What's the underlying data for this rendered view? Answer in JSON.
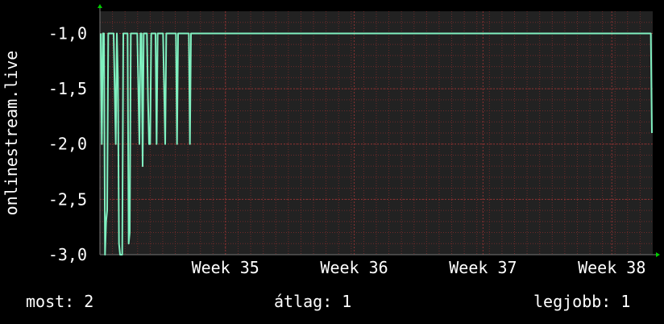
{
  "chart_data": {
    "type": "line",
    "ylabel": "onlinestream.live",
    "ylim": [
      -3.0,
      -0.8
    ],
    "y_ticks": [
      {
        "value": -1.0,
        "label": "-1,0"
      },
      {
        "value": -1.5,
        "label": "-1,5"
      },
      {
        "value": -2.0,
        "label": "-2,0"
      },
      {
        "value": -2.5,
        "label": "-2,5"
      },
      {
        "value": -3.0,
        "label": "-3,0"
      }
    ],
    "x_ticks": [
      {
        "position": 0.227,
        "label": "Week 35"
      },
      {
        "position": 0.46,
        "label": "Week 36"
      },
      {
        "position": 0.693,
        "label": "Week 37"
      },
      {
        "position": 0.926,
        "label": "Week 38"
      }
    ],
    "series": [
      {
        "color": "#80f0c0",
        "values": [
          -1.0,
          -2.0,
          -1.0,
          -1.0,
          -3.0,
          -2.7,
          -2.6,
          -1.0,
          -1.0,
          -1.0,
          -1.0,
          -1.0,
          -1.0,
          -1.5,
          -2.0,
          -1.0,
          -1.4,
          -2.9,
          -3.0,
          -3.0,
          -3.0,
          -1.0,
          -1.0,
          -1.0,
          -1.0,
          -1.0,
          -2.9,
          -2.8,
          -1.0,
          -1.0,
          -1.0,
          -1.0,
          -1.0,
          -1.0,
          -1.0,
          -1.5,
          -2.0,
          -1.0,
          -1.0,
          -2.2,
          -1.0,
          -1.0,
          -1.0,
          -1.0,
          -1.6,
          -2.0,
          -2.0,
          -1.0,
          -1.0,
          -1.0,
          -1.0,
          -1.0,
          -2.0,
          -1.0,
          -1.0,
          -1.0,
          -1.0,
          -1.0,
          -1.0,
          -1.5,
          -2.0,
          -1.0,
          -1.0,
          -1.0,
          -1.0,
          -1.0,
          -1.0,
          -1.0,
          -1.0,
          -1.0,
          -1.0,
          -2.0,
          -1.0,
          -1.0,
          -1.0,
          -1.0,
          -1.0,
          -1.0,
          -1.0,
          -1.0,
          -1.0,
          -1.0,
          -1.0,
          -2.0,
          -1.0,
          -1.0,
          -1.0,
          -1.0,
          -1.0,
          -1.0,
          -1.0,
          -1.0,
          -1.0,
          -1.0,
          -1.0,
          -1.0,
          -1.0,
          -1.0,
          -1.0,
          -1.0,
          -1.0,
          -1.0,
          -1.0,
          -1.0,
          -1.0,
          -1.0,
          -1.0,
          -1.0,
          -1.0,
          -1.0,
          -1.0,
          -1.0,
          -1.0,
          -1.0,
          -1.0,
          -1.0,
          -1.0,
          -1.0,
          -1.0,
          -1.0,
          -1.0,
          -1.0,
          -1.0,
          -1.0,
          -1.0,
          -1.0,
          -1.0,
          -1.0,
          -1.0,
          -1.0,
          -1.0,
          -1.0,
          -1.0,
          -1.0,
          -1.0,
          -1.0,
          -1.0,
          -1.0,
          -1.0,
          -1.0,
          -1.0,
          -1.0,
          -1.0,
          -1.0,
          -1.0,
          -1.0,
          -1.0,
          -1.0,
          -1.0,
          -1.0,
          -1.0,
          -1.0,
          -1.0,
          -1.0,
          -1.0,
          -1.0,
          -1.0,
          -1.0,
          -1.0,
          -1.0,
          -1.0,
          -1.0,
          -1.0,
          -1.0,
          -1.0,
          -1.0,
          -1.0,
          -1.0,
          -1.0,
          -1.0,
          -1.0,
          -1.0,
          -1.0,
          -1.0,
          -1.0,
          -1.0,
          -1.0,
          -1.0,
          -1.0,
          -1.0,
          -1.0,
          -1.0,
          -1.0,
          -1.0,
          -1.0,
          -1.0,
          -1.0,
          -1.0,
          -1.0,
          -1.0,
          -1.0,
          -1.0,
          -1.0,
          -1.0,
          -1.0,
          -1.0,
          -1.0,
          -1.0,
          -1.0,
          -1.0,
          -1.0,
          -1.0,
          -1.0,
          -1.0,
          -1.0,
          -1.0,
          -1.0,
          -1.0,
          -1.0,
          -1.0,
          -1.0,
          -1.0,
          -1.0,
          -1.0,
          -1.0,
          -1.0,
          -1.0,
          -1.0,
          -1.0,
          -1.0,
          -1.0,
          -1.0,
          -1.0,
          -1.0,
          -1.0,
          -1.0,
          -1.0,
          -1.0,
          -1.0,
          -1.0,
          -1.0,
          -1.0,
          -1.0,
          -1.0,
          -1.0,
          -1.0,
          -1.0,
          -1.0,
          -1.0,
          -1.0,
          -1.0,
          -1.0,
          -1.0,
          -1.0,
          -1.0,
          -1.0,
          -1.0,
          -1.0,
          -1.0,
          -1.0,
          -1.0,
          -1.0,
          -1.0,
          -1.0,
          -1.0,
          -1.0,
          -1.0,
          -1.0,
          -1.0,
          -1.0,
          -1.0,
          -1.0,
          -1.0,
          -1.0,
          -1.0,
          -1.0,
          -1.0,
          -1.0,
          -1.0,
          -1.0,
          -1.0,
          -1.0,
          -1.0,
          -1.0,
          -1.0,
          -1.0,
          -1.0,
          -1.0,
          -1.0,
          -1.0,
          -1.0,
          -1.0,
          -1.0,
          -1.0,
          -1.0,
          -1.0,
          -1.0,
          -1.0,
          -1.0,
          -1.0,
          -1.0,
          -1.0,
          -1.0,
          -1.0,
          -1.0,
          -1.0,
          -1.0,
          -1.0,
          -1.0,
          -1.0,
          -1.0,
          -1.0,
          -1.0,
          -1.0,
          -1.0,
          -1.0,
          -1.0,
          -1.0,
          -1.0,
          -1.0,
          -1.0,
          -1.0,
          -1.0,
          -1.0,
          -1.0,
          -1.0,
          -1.0,
          -1.0,
          -1.0,
          -1.0,
          -1.0,
          -1.0,
          -1.0,
          -1.0,
          -1.0,
          -1.0,
          -1.0,
          -1.0,
          -1.0,
          -1.0,
          -1.0,
          -1.0,
          -1.0,
          -1.0,
          -1.0,
          -1.0,
          -1.0,
          -1.0,
          -1.0,
          -1.0,
          -1.0,
          -1.0,
          -1.0,
          -1.0,
          -1.0,
          -1.0,
          -1.0,
          -1.0,
          -1.0,
          -1.0,
          -1.0,
          -1.0,
          -1.0,
          -1.0,
          -1.0,
          -1.0,
          -1.0,
          -1.0,
          -1.0,
          -1.0,
          -1.0,
          -1.0,
          -1.0,
          -1.0,
          -1.0,
          -1.0,
          -1.0,
          -1.0,
          -1.0,
          -1.0,
          -1.0,
          -1.0,
          -1.0,
          -1.0,
          -1.0,
          -1.0,
          -1.0,
          -1.0,
          -1.0,
          -1.0,
          -1.0,
          -1.0,
          -1.0,
          -1.0,
          -1.0,
          -1.0,
          -1.0,
          -1.0,
          -1.0,
          -1.0,
          -1.0,
          -1.0,
          -1.0,
          -1.0,
          -1.0,
          -1.0,
          -1.0,
          -1.0,
          -1.0,
          -1.0,
          -1.0,
          -1.0,
          -1.0,
          -1.0,
          -1.0,
          -1.0,
          -1.0,
          -1.0,
          -1.0,
          -1.0,
          -1.0,
          -1.0,
          -1.0,
          -1.0,
          -1.0,
          -1.0,
          -1.0,
          -1.0,
          -1.0,
          -1.0,
          -1.0,
          -1.0,
          -1.0,
          -1.0,
          -1.0,
          -1.0,
          -1.0,
          -1.0,
          -1.0,
          -1.0,
          -1.0,
          -1.0,
          -1.0,
          -1.0,
          -1.0,
          -1.0,
          -1.0,
          -1.0,
          -1.0,
          -1.0,
          -1.0,
          -1.0,
          -1.0,
          -1.0,
          -1.0,
          -1.0,
          -1.0,
          -1.0,
          -1.0,
          -1.0,
          -1.0,
          -1.0,
          -1.0,
          -1.0,
          -1.0,
          -1.0,
          -1.0,
          -1.0,
          -1.0,
          -1.0,
          -1.0,
          -1.0,
          -1.0,
          -1.0,
          -1.0,
          -1.0,
          -1.0,
          -1.0,
          -1.0,
          -1.0,
          -1.0,
          -1.0,
          -1.0,
          -1.0,
          -1.0,
          -1.0,
          -1.0,
          -1.0,
          -1.0,
          -1.0,
          -1.0,
          -1.0,
          -1.0,
          -1.0,
          -1.0,
          -1.0,
          -1.0,
          -1.0,
          -1.0,
          -1.0,
          -1.0,
          -1.0,
          -1.0,
          -1.0,
          -1.0,
          -1.0,
          -1.0,
          -1.0,
          -1.0,
          -1.0,
          -1.0,
          -1.0,
          -1.0,
          -1.0,
          -1.0,
          -1.0,
          -1.0,
          -1.0,
          -1.0,
          -1.0,
          -1.0,
          -1.0,
          -1.0,
          -1.9
        ]
      }
    ],
    "grid": true,
    "background": "#000000",
    "plot_background": "#222222",
    "grid_color": "#6e2a2a",
    "axis_arrow_color": "#00cc00"
  },
  "footer": {
    "current": "most: 2",
    "average": "átlag: 1",
    "best": "legjobb: 1"
  }
}
